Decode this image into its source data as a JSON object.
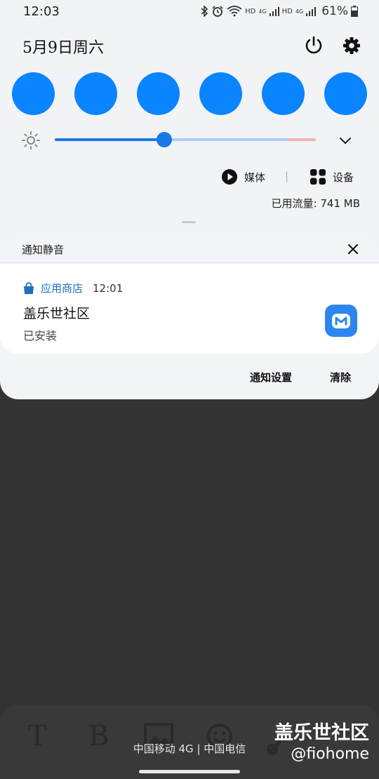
{
  "status_bar": {
    "time": "12:03",
    "icons": [
      "bluetooth-icon",
      "alarm-icon",
      "wifi-icon",
      "hd-volte-icon",
      "signal-icon",
      "battery-icon"
    ],
    "hd1": "HD",
    "net1": "4G",
    "hd2": "HD",
    "net2": "4G",
    "battery": "61%"
  },
  "header": {
    "date": "5月9日周六",
    "power_icon": "power-icon",
    "settings_icon": "gear-icon"
  },
  "quick_toggles": {
    "count": 6,
    "color": "#0a84ff"
  },
  "brightness": {
    "level": 0.42,
    "icon": "sun-icon"
  },
  "media_row": {
    "media_label": "媒体",
    "separator": "|",
    "devices_label": "设备"
  },
  "data_usage": "已用流量: 741 MB",
  "notifications": {
    "header_title": "通知静音",
    "app_name": "应用商店",
    "time": "12:01",
    "title": "盖乐世社区",
    "body": "已安装",
    "settings_label": "通知设置",
    "clear_label": "清除"
  },
  "background_app": {
    "tools": [
      "T",
      "B"
    ],
    "carrier": "中国移动 4G | 中国电信"
  },
  "watermark": {
    "title": "盖乐世社区",
    "handle": "@fiohome"
  },
  "colors": {
    "accent": "#0a84ff",
    "slider": "#1679e6",
    "app_icon": "#2b86f0",
    "scrim": "#333333"
  }
}
